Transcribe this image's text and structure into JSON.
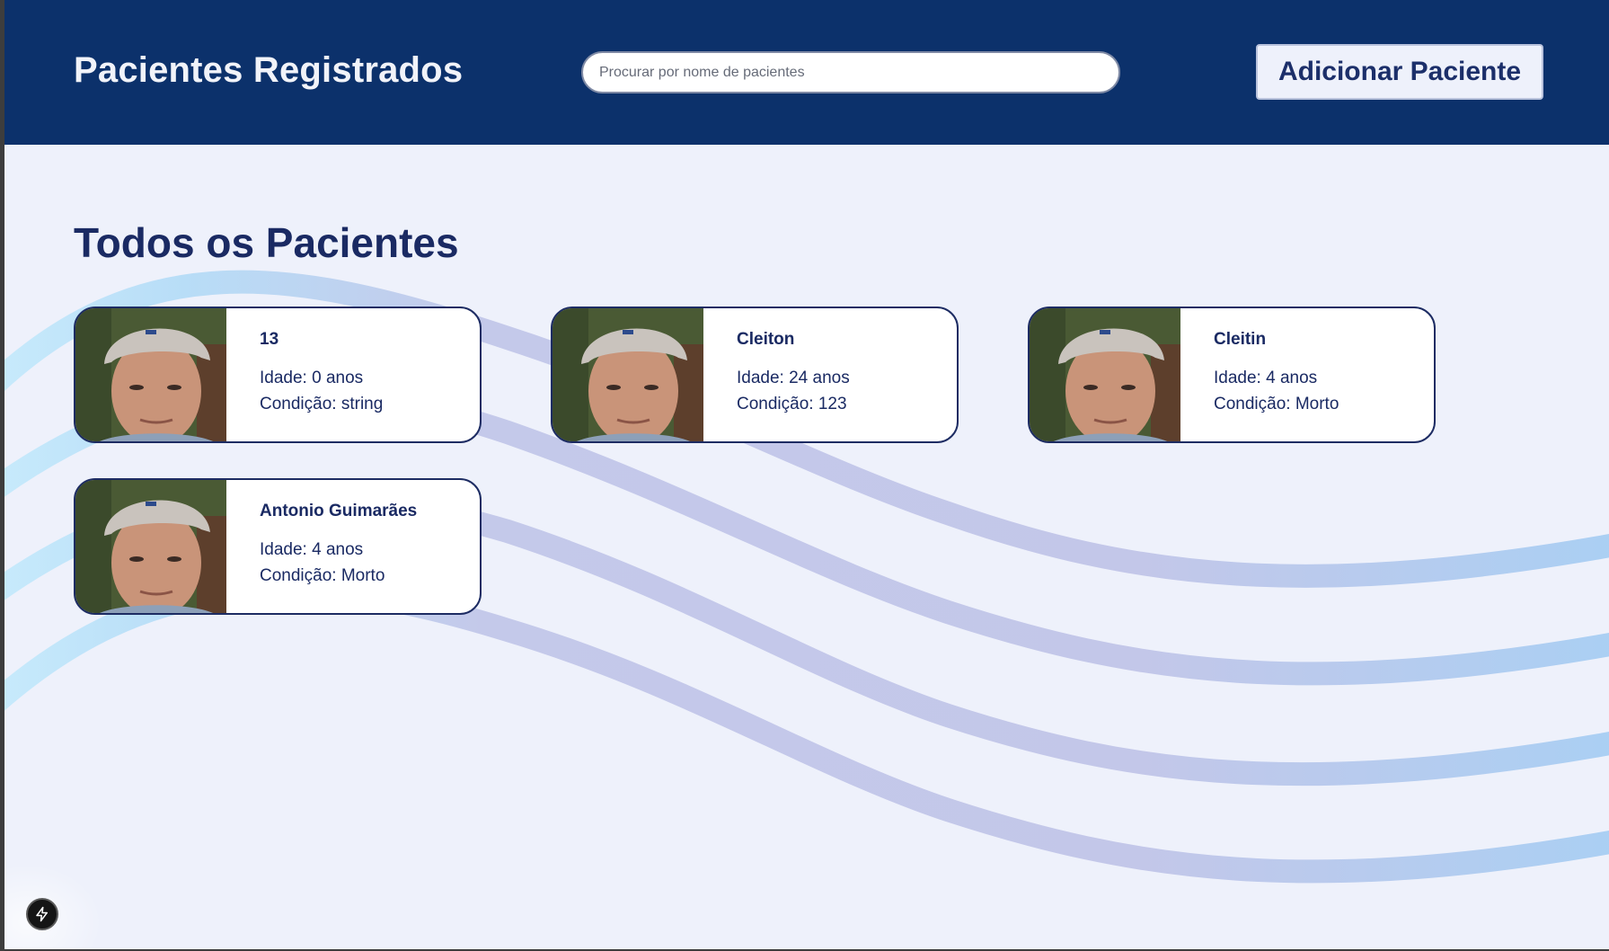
{
  "header": {
    "title": "Pacientes Registrados",
    "search_placeholder": "Procurar por nome de pacientes",
    "add_button_label": "Adicionar Paciente"
  },
  "main": {
    "section_title": "Todos os Pacientes",
    "patients": [
      {
        "name": "13",
        "age": "Idade: 0 anos",
        "condition": "Condição: string"
      },
      {
        "name": "Cleiton",
        "age": "Idade: 24 anos",
        "condition": "Condição: 123"
      },
      {
        "name": "Cleitin",
        "age": "Idade: 4 anos",
        "condition": "Condição: Morto"
      },
      {
        "name": "Antonio Guimarães",
        "age": "Idade: 4 anos",
        "condition": "Condição: Morto"
      }
    ]
  },
  "colors": {
    "header_bg": "#0c316b",
    "page_bg": "#eef1fb",
    "text_primary": "#1a2a63",
    "card_border": "#1d2c63",
    "wave_light": "#b3e2fb",
    "wave_mid": "#c3c7e9"
  },
  "icons": {
    "fab": "lightning-bolt-icon",
    "patient_photo": "patient-avatar-photo"
  }
}
